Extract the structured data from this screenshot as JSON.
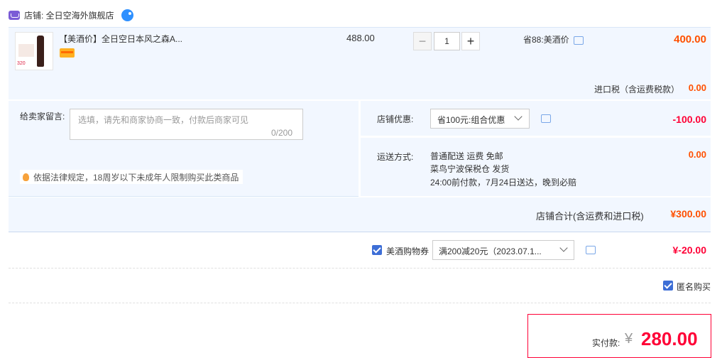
{
  "shop": {
    "label": "店铺: 全日空海外旗舰店"
  },
  "item": {
    "thumb_price": "320",
    "title": "【美酒价】全日空日本风之森A...",
    "unit_price": "488.00",
    "quantity": "1",
    "saving": "省88:美酒价",
    "total": "400.00",
    "qty_minus": "−",
    "qty_plus": "+"
  },
  "import_tax": {
    "label": "进口税（含运费税款）",
    "value": "0.00"
  },
  "message": {
    "label": "给卖家留言:",
    "placeholder": "选填，请先和商家协商一致，付款后商家可见",
    "count": "0/200",
    "law_notice": "依据法律规定，18周岁以下未成年人限制购买此类商品"
  },
  "shop_discount": {
    "label": "店铺优惠:",
    "selected": "省100元:组合优惠",
    "value": "-100.00"
  },
  "shipping": {
    "label": "运送方式:",
    "line1": "普通配送 运费 免邮",
    "line2": "菜鸟宁波保税仓    发货",
    "line3": "24:00前付款，7月24日送达，晚到必赔",
    "value": "0.00"
  },
  "subtotal": {
    "label": "店铺合计(含运费和进口税)",
    "value": "¥300.00"
  },
  "coupon": {
    "label": "美酒购物券",
    "selected": "满200减20元（2023.07.1...",
    "value": "¥-20.00"
  },
  "anonymous": {
    "label": "匿名购买"
  },
  "payment": {
    "label": "实付款:",
    "currency": "¥",
    "value": "280.00"
  },
  "colors": {
    "accent_orange": "#ff5000",
    "accent_red": "#ff0036",
    "panel_bg": "#f2f7ff",
    "check_blue": "#3d6ed6"
  }
}
